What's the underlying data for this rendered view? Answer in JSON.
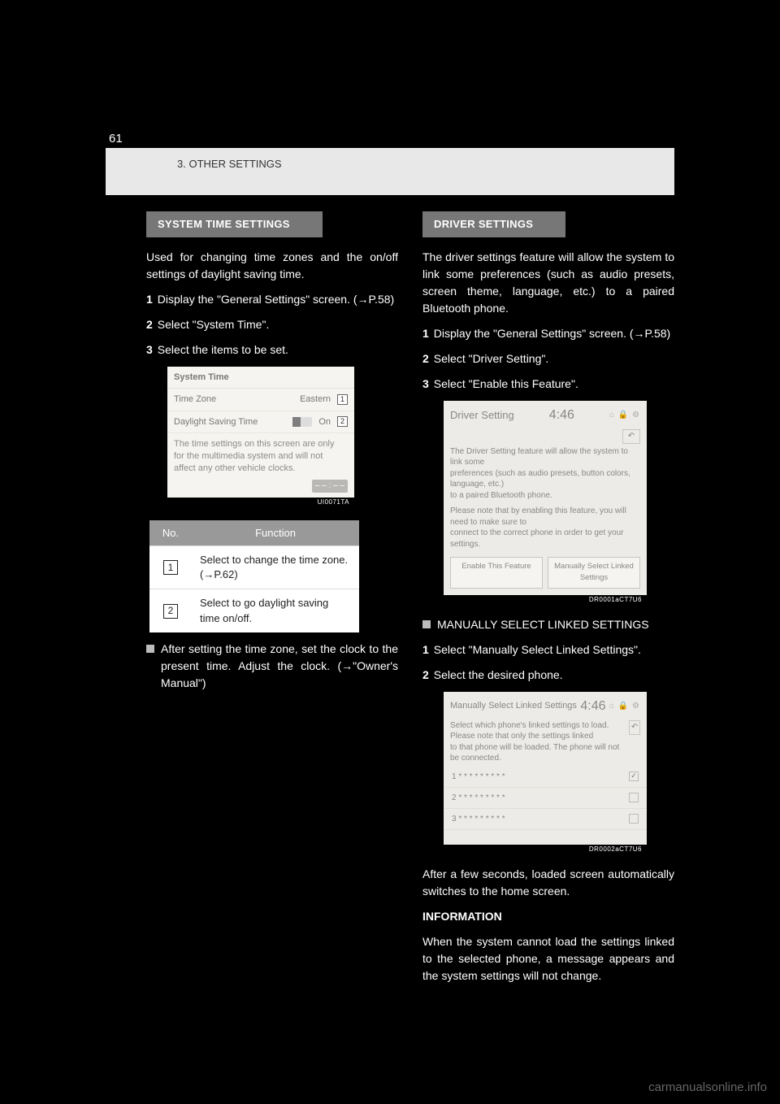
{
  "page_number": "61",
  "breadcrumb": "3. OTHER SETTINGS",
  "watermark": "carmanualsonline.info",
  "left": {
    "heading": "SYSTEM TIME SETTINGS",
    "intro": "Used for changing time zones and the on/off settings of daylight saving time.",
    "step1_num": "1",
    "step1_text": "Display the \"General Settings\" screen. (→P.58)",
    "step2_num": "2",
    "step2_text": "Select \"System Time\".",
    "step3_num": "3",
    "step3_text": "Select the items to be set.",
    "screenshot": {
      "title": "System Time",
      "row1_label": "Time Zone",
      "row1_value": "Eastern",
      "row1_marker": "1",
      "row2_label": "Daylight Saving Time",
      "row2_value": "On",
      "row2_marker": "2",
      "note_l1": "The time settings on this screen are only",
      "note_l2": "for the multimedia system and will not",
      "note_l3": "affect any other vehicle clocks.",
      "id": "UI0071TA"
    },
    "table": {
      "header_no": "No.",
      "header_fn": "Function",
      "r1_no": "1",
      "r1_fn": "Select to change the time zone. (→P.62)",
      "r2_no": "2",
      "r2_fn": "Select to go daylight saving time on/off."
    },
    "info_bullet": "After setting the time zone, set the clock to the present time. Adjust the clock. (→\"Owner's Manual\")"
  },
  "right": {
    "heading": "DRIVER SETTINGS",
    "intro": "The driver settings feature will allow the system to link some preferences (such as audio presets, screen theme, language, etc.) to a paired Bluetooth phone.",
    "step1_num": "1",
    "step1_text": "Display the \"General Settings\" screen. (→P.58)",
    "step2_num": "2",
    "step2_text": "Select \"Driver Setting\".",
    "step3_num": "3",
    "step3_text": "Select \"Enable this Feature\".",
    "screenshot1": {
      "title": "Driver Setting",
      "clock": "4:46",
      "desc_l1": "The Driver Setting feature will allow the system to link some",
      "desc_l2": "preferences (such as audio presets, button colors, language, etc.)",
      "desc_l3": "to a paired Bluetooth phone.",
      "desc_l4": "Please note that by enabling this feature, you will need to make sure to",
      "desc_l5": "connect to the correct phone in order to get your settings.",
      "btn1": "Enable This Feature",
      "btn2": "Manually Select Linked Settings",
      "id": "DR0001aCT7U6"
    },
    "mid_bullet": "MANUALLY SELECT LINKED SETTINGS",
    "m_step1_num": "1",
    "m_step1_text": "Select \"Manually Select Linked Settings\".",
    "m_step2_num": "2",
    "m_step2_text": "Select the desired phone.",
    "screenshot2": {
      "title": "Manually Select Linked Settings",
      "clock": "4:46",
      "hint_l1": "Select which phone's linked settings to load. Please note that only the settings linked",
      "hint_l2": "to that phone will be loaded. The phone will not be connected.",
      "row1": "1  * * * * * * * * *",
      "row2": "2  * * * * * * * * *",
      "row3": "3  * * * * * * * * *",
      "id": "DR0002aCT7U6"
    },
    "after1": "After a few seconds, loaded screen automatically switches to the home screen.",
    "info_bullet": "INFORMATION",
    "info_text": "When the system cannot load the settings linked to the selected phone, a message appears and the system settings will not change."
  }
}
